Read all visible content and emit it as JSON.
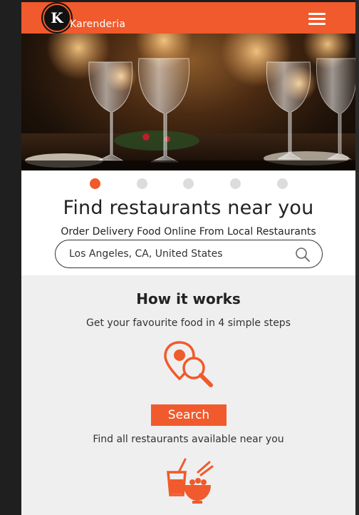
{
  "header": {
    "logo_letter": "K",
    "logo_text": "Karenderia",
    "brand_color": "#f05a2c",
    "menu_icon": "hamburger-menu-icon"
  },
  "hero": {
    "image": "restaurant wine glasses photo",
    "slides_count": 5,
    "active_slide": 1
  },
  "search_section": {
    "title": "Find restaurants near you",
    "subtitle": "Order Delivery Food Online From Local Restaurants",
    "input_value": "Los Angeles, CA, United States",
    "search_icon": "magnifier-icon"
  },
  "how_it_works": {
    "title": "How it works",
    "subtitle": "Get your favourite food in 4 simple steps",
    "steps": [
      {
        "icon": "map-pin-magnifier-icon",
        "label": "Search",
        "description": "Find all restaurants available near you"
      },
      {
        "icon": "food-bowl-drink-icon"
      }
    ]
  }
}
